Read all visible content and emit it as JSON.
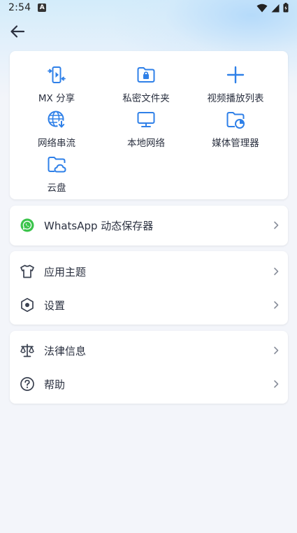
{
  "status_bar": {
    "time": "2:54",
    "notification_icon": "a-notification-icon",
    "icons": [
      "wifi-icon",
      "signal-icon",
      "battery-charging-icon"
    ]
  },
  "header": {
    "back_icon": "arrow-left-icon"
  },
  "quick_actions": [
    {
      "label": "MX 分享",
      "icon": "share-transfer-icon"
    },
    {
      "label": "私密文件夹",
      "icon": "lock-folder-icon"
    },
    {
      "label": "视频播放列表",
      "icon": "plus-icon"
    },
    {
      "label": "网络串流",
      "icon": "globe-download-icon"
    },
    {
      "label": "本地网络",
      "icon": "monitor-icon"
    },
    {
      "label": "媒体管理器",
      "icon": "folder-chart-icon"
    },
    {
      "label": "云盘",
      "icon": "cloud-folder-icon"
    }
  ],
  "whatsapp": {
    "label": "WhatsApp 动态保存器",
    "icon": "whatsapp-icon",
    "color": "#3bc44b"
  },
  "settings_group": [
    {
      "label": "应用主题",
      "icon": "shirt-icon"
    },
    {
      "label": "设置",
      "icon": "hexagon-settings-icon"
    }
  ],
  "info_group": [
    {
      "label": "法律信息",
      "icon": "scales-icon"
    },
    {
      "label": "帮助",
      "icon": "question-circle-icon"
    }
  ],
  "colors": {
    "accent": "#2f80e8",
    "text": "#2b3140",
    "icon_gray": "#3a4150",
    "background": "#f3f5fa"
  }
}
